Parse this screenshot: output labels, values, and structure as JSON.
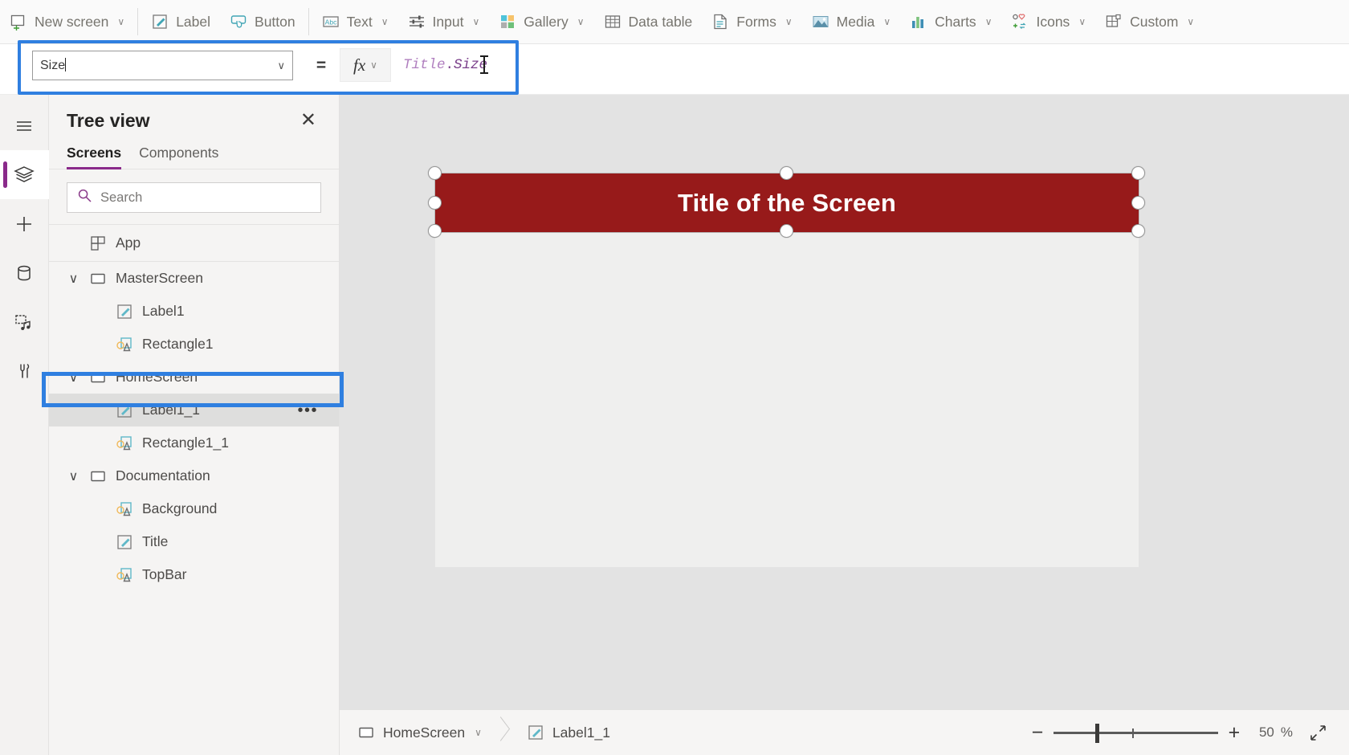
{
  "toolbar": {
    "items": [
      {
        "label": "New screen",
        "icon": "new-screen-icon",
        "caret": "∨"
      },
      {
        "label": "Label",
        "icon": "label-icon",
        "caret": ""
      },
      {
        "label": "Button",
        "icon": "button-icon",
        "caret": ""
      },
      {
        "label": "Text",
        "icon": "text-icon",
        "caret": "∨"
      },
      {
        "label": "Input",
        "icon": "input-icon",
        "caret": "∨"
      },
      {
        "label": "Gallery",
        "icon": "gallery-icon",
        "caret": "∨"
      },
      {
        "label": "Data table",
        "icon": "data-table-icon",
        "caret": ""
      },
      {
        "label": "Forms",
        "icon": "forms-icon",
        "caret": "∨"
      },
      {
        "label": "Media",
        "icon": "media-icon",
        "caret": "∨"
      },
      {
        "label": "Charts",
        "icon": "charts-icon",
        "caret": "∨"
      },
      {
        "label": "Icons",
        "icon": "icons-icon",
        "caret": "∨"
      },
      {
        "label": "Custom",
        "icon": "custom-icon",
        "caret": "∨"
      }
    ]
  },
  "formula_bar": {
    "property_value": "Size",
    "property_caret": "∨",
    "equals": "=",
    "fx_label": "fx",
    "fx_caret": "∨",
    "formula_identifier": "Title",
    "formula_dot": ".",
    "formula_property": "Size",
    "highlight_color": "#2f7fe0"
  },
  "rail": {
    "items": [
      {
        "name": "hamburger-menu-icon",
        "active": false
      },
      {
        "name": "tree-view-icon",
        "active": true
      },
      {
        "name": "insert-icon",
        "active": false
      },
      {
        "name": "data-icon",
        "active": false
      },
      {
        "name": "media-library-icon",
        "active": false
      },
      {
        "name": "advanced-tools-icon",
        "active": false
      }
    ],
    "accent_color": "#8a2a8a"
  },
  "tree_view": {
    "title": "Tree view",
    "close_label": "✕",
    "tabs": [
      {
        "label": "Screens",
        "selected": true
      },
      {
        "label": "Components",
        "selected": false
      }
    ],
    "search_placeholder": "Search",
    "search_value": "",
    "app_item": {
      "label": "App",
      "icon": "app-icon"
    },
    "nodes": [
      {
        "label": "MasterScreen",
        "icon": "screen-icon",
        "level": 0,
        "expander": "∨",
        "selected": false,
        "dots": ""
      },
      {
        "label": "Label1",
        "icon": "label-control-icon",
        "level": 1,
        "expander": "",
        "selected": false,
        "dots": ""
      },
      {
        "label": "Rectangle1",
        "icon": "shape-control-icon",
        "level": 1,
        "expander": "",
        "selected": false,
        "dots": ""
      },
      {
        "label": "HomeScreen",
        "icon": "screen-icon",
        "level": 0,
        "expander": "∨",
        "selected": false,
        "dots": ""
      },
      {
        "label": "Label1_1",
        "icon": "label-control-icon",
        "level": 1,
        "expander": "",
        "selected": true,
        "dots": "•••"
      },
      {
        "label": "Rectangle1_1",
        "icon": "shape-control-icon",
        "level": 1,
        "expander": "",
        "selected": false,
        "dots": ""
      },
      {
        "label": "Documentation",
        "icon": "screen-icon",
        "level": 0,
        "expander": "∨",
        "selected": false,
        "dots": ""
      },
      {
        "label": "Background",
        "icon": "shape-control-icon",
        "level": 1,
        "expander": "",
        "selected": false,
        "dots": ""
      },
      {
        "label": "Title",
        "icon": "label-control-icon",
        "level": 1,
        "expander": "",
        "selected": false,
        "dots": ""
      },
      {
        "label": "TopBar",
        "icon": "shape-control-icon",
        "level": 1,
        "expander": "",
        "selected": false,
        "dots": ""
      }
    ]
  },
  "canvas": {
    "screen_title": "Title of the Screen",
    "title_band_color": "#971a1a",
    "title_text_color": "#ffffff",
    "screen_body_color": "#efefee",
    "canvas_background": "#e3e3e3"
  },
  "status_bar": {
    "breadcrumb": [
      {
        "label": "HomeScreen",
        "icon": "screen-icon",
        "caret": "∨"
      },
      {
        "label": "Label1_1",
        "icon": "label-control-icon",
        "caret": ""
      }
    ],
    "zoom_out": "−",
    "zoom_in": "+",
    "zoom_value": "50",
    "zoom_unit": "%",
    "fit_screen": "fit-screen-icon"
  }
}
